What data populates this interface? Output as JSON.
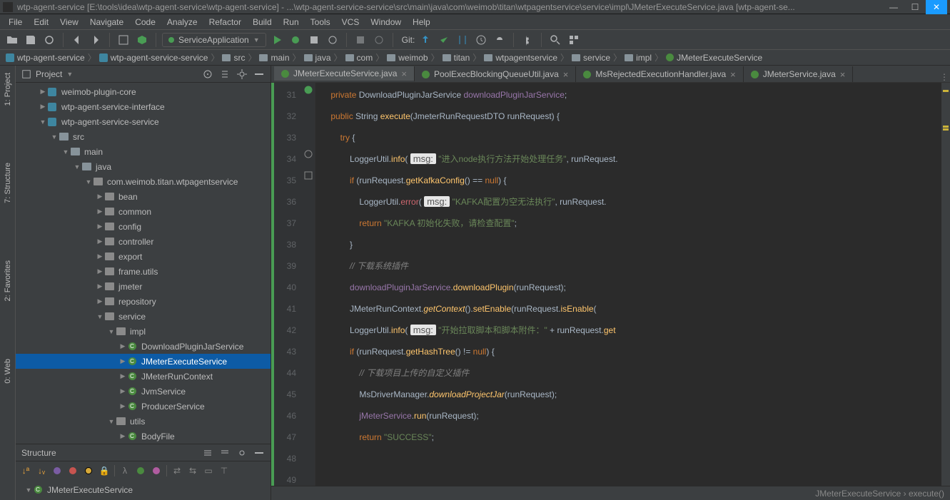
{
  "titlebar": "wtp-agent-service [E:\\tools\\idea\\wtp-agent-service\\wtp-agent-service] - ...\\wtp-agent-service-service\\src\\main\\java\\com\\weimob\\titan\\wtpagentservice\\service\\impl\\JMeterExecuteService.java [wtp-agent-se...",
  "menu": [
    "File",
    "Edit",
    "View",
    "Navigate",
    "Code",
    "Analyze",
    "Refactor",
    "Build",
    "Run",
    "Tools",
    "VCS",
    "Window",
    "Help"
  ],
  "run_config": "ServiceApplication",
  "git_label": "Git:",
  "breadcrumbs": [
    {
      "icon": "module",
      "label": "wtp-agent-service"
    },
    {
      "icon": "module",
      "label": "wtp-agent-service-service"
    },
    {
      "icon": "folder",
      "label": "src"
    },
    {
      "icon": "folder",
      "label": "main"
    },
    {
      "icon": "folder",
      "label": "java"
    },
    {
      "icon": "folder",
      "label": "com"
    },
    {
      "icon": "folder",
      "label": "weimob"
    },
    {
      "icon": "folder",
      "label": "titan"
    },
    {
      "icon": "folder",
      "label": "wtpagentservice"
    },
    {
      "icon": "folder",
      "label": "service"
    },
    {
      "icon": "folder",
      "label": "impl"
    },
    {
      "icon": "class",
      "label": "JMeterExecuteService"
    }
  ],
  "left_tabs": [
    "1: Project",
    "7: Structure",
    "2: Favorites",
    "0: Web"
  ],
  "project_panel": {
    "title": "Project",
    "tree": [
      {
        "d": 2,
        "arrow": "▶",
        "ic": "module",
        "label": "weimob-plugin-core"
      },
      {
        "d": 2,
        "arrow": "▶",
        "ic": "module",
        "label": "wtp-agent-service-interface"
      },
      {
        "d": 2,
        "arrow": "▼",
        "ic": "module",
        "label": "wtp-agent-service-service"
      },
      {
        "d": 3,
        "arrow": "▼",
        "ic": "folder",
        "label": "src"
      },
      {
        "d": 4,
        "arrow": "▼",
        "ic": "folder",
        "label": "main"
      },
      {
        "d": 5,
        "arrow": "▼",
        "ic": "folder",
        "label": "java"
      },
      {
        "d": 6,
        "arrow": "▼",
        "ic": "pkg",
        "label": "com.weimob.titan.wtpagentservice"
      },
      {
        "d": 7,
        "arrow": "▶",
        "ic": "pkg",
        "label": "bean"
      },
      {
        "d": 7,
        "arrow": "▶",
        "ic": "pkg",
        "label": "common"
      },
      {
        "d": 7,
        "arrow": "▶",
        "ic": "pkg",
        "label": "config"
      },
      {
        "d": 7,
        "arrow": "▶",
        "ic": "pkg",
        "label": "controller"
      },
      {
        "d": 7,
        "arrow": "▶",
        "ic": "pkg",
        "label": "export"
      },
      {
        "d": 7,
        "arrow": "▶",
        "ic": "pkg",
        "label": "frame.utils"
      },
      {
        "d": 7,
        "arrow": "▶",
        "ic": "pkg",
        "label": "jmeter"
      },
      {
        "d": 7,
        "arrow": "▶",
        "ic": "pkg",
        "label": "repository"
      },
      {
        "d": 7,
        "arrow": "▼",
        "ic": "pkg",
        "label": "service"
      },
      {
        "d": 8,
        "arrow": "▼",
        "ic": "pkg",
        "label": "impl"
      },
      {
        "d": 9,
        "arrow": "▶",
        "ic": "class",
        "label": "DownloadPluginJarService"
      },
      {
        "d": 9,
        "arrow": "▶",
        "ic": "class",
        "label": "JMeterExecuteService",
        "selected": true
      },
      {
        "d": 9,
        "arrow": "▶",
        "ic": "class",
        "label": "JMeterRunContext"
      },
      {
        "d": 9,
        "arrow": "▶",
        "ic": "class",
        "label": "JvmService"
      },
      {
        "d": 9,
        "arrow": "▶",
        "ic": "class",
        "label": "ProducerService"
      },
      {
        "d": 8,
        "arrow": "▼",
        "ic": "pkg",
        "label": "utils"
      },
      {
        "d": 9,
        "arrow": "▶",
        "ic": "class",
        "label": "BodyFile"
      }
    ]
  },
  "structure_panel": {
    "title": "Structure",
    "current": "JMeterExecuteService"
  },
  "editor": {
    "tabs": [
      {
        "label": "JMeterExecuteService.java",
        "active": true
      },
      {
        "label": "PoolExecBlockingQueueUtil.java"
      },
      {
        "label": "MsRejectedExecutionHandler.java"
      },
      {
        "label": "JMeterService.java"
      }
    ],
    "lines": [
      31,
      32,
      33,
      34,
      35,
      36,
      37,
      38,
      39,
      40,
      41,
      42,
      43,
      44,
      45,
      46,
      47,
      48,
      49
    ],
    "code": {
      "l31": {
        "kw": "private",
        "type": "DownloadPluginJarService",
        "fld": "downloadPluginJarService",
        ";": ";"
      },
      "l34": {
        "kw1": "public",
        "type": "String",
        "mth": "execute",
        "args": "(JmeterRunRequestDTO runRequest) {"
      },
      "l35": {
        "kw": "try",
        "txt": " {"
      },
      "l36": {
        "cls": "LoggerUtil",
        "dot": ".",
        "mth": "info",
        "badge": "msg:",
        "str": "\"进入node执行方法开始处理任务\"",
        "tail": ", runRequest."
      },
      "l37": {
        "kw": "if",
        "txt": " (runRequest.",
        "mth": "getKafkaConfig",
        "txt2": "() == ",
        "kw2": "null",
        "txt3": ") {"
      },
      "l38": {
        "cls": "LoggerUtil",
        "dot": ".",
        "err": "error",
        "badge": "msg:",
        "str": "\"KAFKA配置为空无法执行\"",
        "tail": ", runRequest."
      },
      "l39": {
        "kw": "return",
        "str": " \"KAFKA 初始化失败，请检查配置\"",
        "semi": ";"
      },
      "l40": "            }",
      "l41": "// 下载系统插件",
      "l42": {
        "fld": "downloadPluginJarService",
        "dot": ".",
        "mth": "downloadPlugin",
        "txt": "(runRequest);"
      },
      "l43": {
        "cls": "JMeterRunContext",
        "dot": ".",
        "ital": "getContext",
        "txt": "().",
        "mth": "setEnable",
        "txt2": "(runRequest.",
        "mth2": "isEnable",
        "txt3": "("
      },
      "l44": {
        "cls": "LoggerUtil",
        "dot": ".",
        "mth": "info",
        "badge": "msg:",
        "str": "\"开始拉取脚本和脚本附件：\"",
        "txt": " + runRequest.",
        "mth2": "get"
      },
      "l45": {
        "kw": "if",
        "txt": " (runRequest.",
        "mth": "getHashTree",
        "txt2": "() != ",
        "kw2": "null",
        "txt3": ") {"
      },
      "l46": "// 下载项目上传的自定义插件",
      "l47": {
        "cls": "MsDriverManager",
        "dot": ".",
        "ital": "downloadProjectJar",
        "txt": "(runRequest);"
      },
      "l48": {
        "fld": "jMeterService",
        "dot": ".",
        "mth": "run",
        "txt": "(runRequest);"
      },
      "l49": {
        "kw": "return",
        "str": " \"SUCCESS\"",
        "semi": ";"
      }
    },
    "status_crumb": "JMeterExecuteService  ›  execute()"
  }
}
